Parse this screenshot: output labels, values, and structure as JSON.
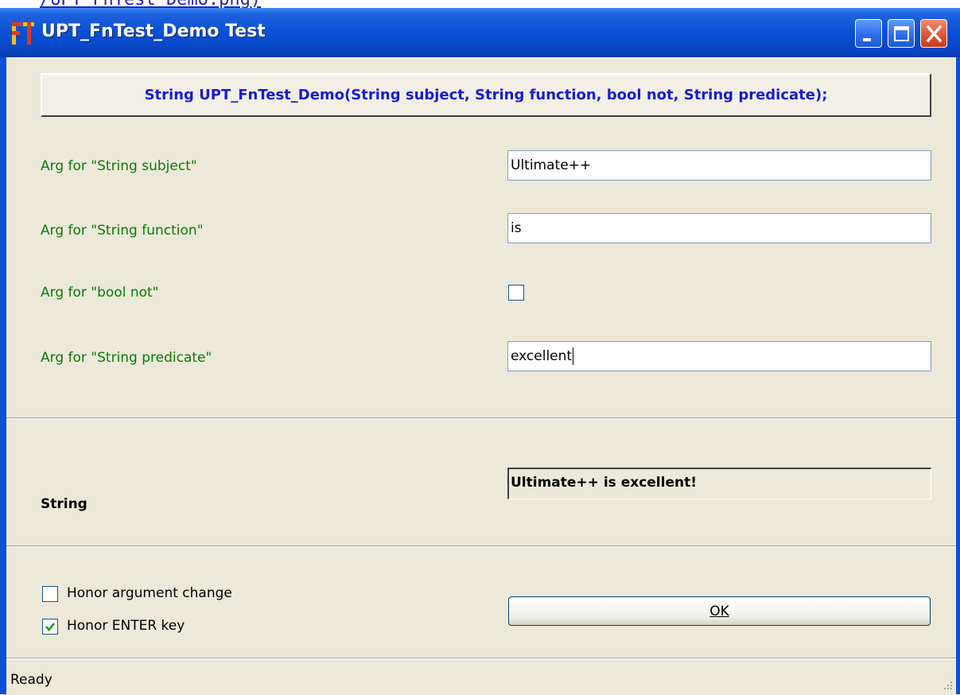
{
  "top_strip": {
    "text": "/UPT_FnTest_Demo.png)"
  },
  "window": {
    "title": "UPT_FnTest_Demo Test",
    "icon": "ft-app-icon",
    "controls": [
      "minimize-icon",
      "maximize-icon",
      "close-icon"
    ]
  },
  "signature_button": {
    "label": "String UPT_FnTest_Demo(String subject, String function, bool not, String predicate);"
  },
  "args": [
    {
      "label": "Arg for \"String subject\"",
      "value": "Ultimate++"
    },
    {
      "label": "Arg for \"String function\"",
      "value": "is"
    },
    {
      "label": "Arg for \"bool not\"",
      "checked": false
    },
    {
      "label": "Arg for \"String predicate\"",
      "value": "excellent"
    }
  ],
  "result": {
    "label": "String",
    "value": "Ultimate++ is excellent!"
  },
  "options": [
    {
      "label": "Honor argument change",
      "checked": false
    },
    {
      "label": "Honor ENTER key",
      "checked": true
    }
  ],
  "ok_button": {
    "label": "OK"
  },
  "status": {
    "text": "Ready"
  },
  "colors": {
    "title_bar": "#0a4fd6",
    "label_green": "#0a7a0a",
    "signature_blue": "#1b1bd0",
    "background": "#ece9d8"
  }
}
